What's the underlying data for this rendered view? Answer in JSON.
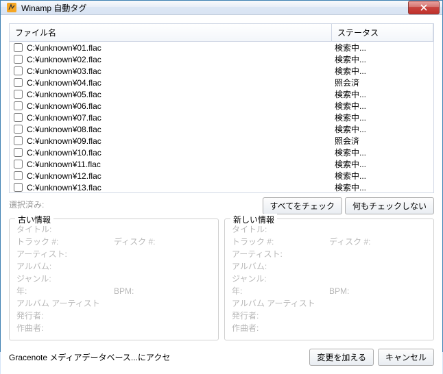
{
  "window": {
    "title": "Winamp 自動タグ"
  },
  "columns": {
    "file": "ファイル名",
    "status": "ステータス"
  },
  "rows": [
    {
      "file": "C:¥unknown¥01.flac",
      "status": "検索中..."
    },
    {
      "file": "C:¥unknown¥02.flac",
      "status": "検索中..."
    },
    {
      "file": "C:¥unknown¥03.flac",
      "status": "検索中..."
    },
    {
      "file": "C:¥unknown¥04.flac",
      "status": "照会済"
    },
    {
      "file": "C:¥unknown¥05.flac",
      "status": "検索中..."
    },
    {
      "file": "C:¥unknown¥06.flac",
      "status": "検索中..."
    },
    {
      "file": "C:¥unknown¥07.flac",
      "status": "検索中..."
    },
    {
      "file": "C:¥unknown¥08.flac",
      "status": "検索中..."
    },
    {
      "file": "C:¥unknown¥09.flac",
      "status": "照会済"
    },
    {
      "file": "C:¥unknown¥10.flac",
      "status": "検索中..."
    },
    {
      "file": "C:¥unknown¥11.flac",
      "status": "検索中..."
    },
    {
      "file": "C:¥unknown¥12.flac",
      "status": "検索中..."
    },
    {
      "file": "C:¥unknown¥13.flac",
      "status": "検索中..."
    }
  ],
  "selected_label": "選択済み:",
  "buttons": {
    "check_all": "すべてをチェック",
    "check_none": "何もチェックしない",
    "apply": "変更を加える",
    "cancel": "キャンセル"
  },
  "panels": {
    "old_title": "古い情報",
    "new_title": "新しい情報"
  },
  "info_labels": {
    "title": "タイトル:",
    "track": "トラック #:",
    "disc": "ディスク #:",
    "artist": "アーティスト:",
    "album": "アルバム:",
    "genre": "ジャンル:",
    "year": "年:",
    "bpm": "BPM:",
    "album_artist": "アルバム アーティスト",
    "publisher": "発行者:",
    "composer": "作曲者:"
  },
  "footer_text": "Gracenote メディアデータベース...にアクセ"
}
